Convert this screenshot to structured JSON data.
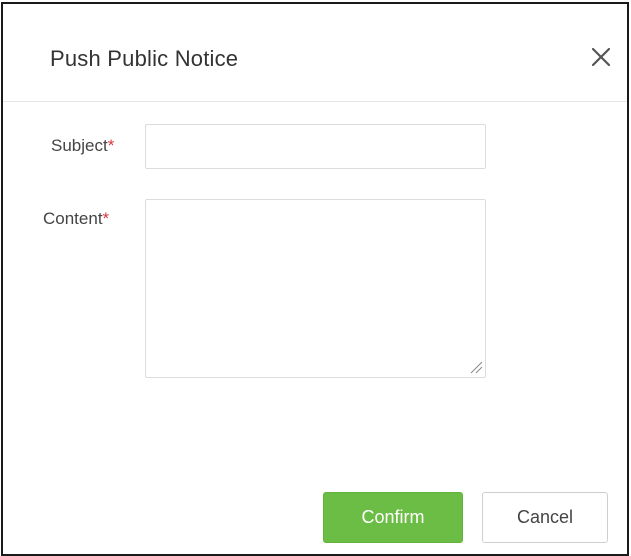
{
  "dialog": {
    "title": "Push Public Notice",
    "close_icon": "close-icon"
  },
  "form": {
    "subject": {
      "label": "Subject",
      "required_mark": "*",
      "value": "",
      "placeholder": ""
    },
    "content": {
      "label": "Content",
      "required_mark": "*",
      "value": "",
      "placeholder": ""
    }
  },
  "actions": {
    "confirm_label": "Confirm",
    "cancel_label": "Cancel"
  },
  "colors": {
    "accent": "#6cbd45",
    "required": "#d9363e",
    "border": "#dcdcdc"
  }
}
